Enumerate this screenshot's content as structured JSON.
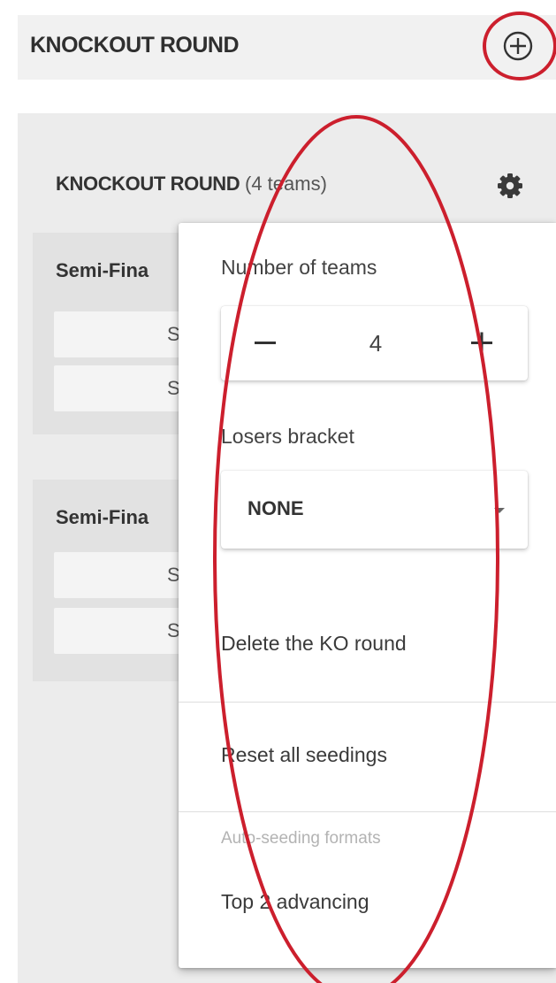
{
  "header": {
    "title": "KNOCKOUT ROUND"
  },
  "round": {
    "title": "KNOCKOUT ROUND",
    "team_count_label": "(4 teams)"
  },
  "matches": [
    {
      "title": "Semi-Fina",
      "slots": [
        "S",
        "S"
      ]
    },
    {
      "title": "Semi-Fina",
      "slots": [
        "S",
        "S"
      ]
    }
  ],
  "menu": {
    "number_of_teams_label": "Number of teams",
    "number_of_teams_value": "4",
    "losers_bracket_label": "Losers bracket",
    "losers_bracket_value": "NONE",
    "delete_label": "Delete the KO round",
    "reset_label": "Reset all seedings",
    "auto_seeding_header": "Auto-seeding formats",
    "auto_seeding_items": [
      "Top 2 advancing"
    ]
  },
  "colors": {
    "annotation": "#cc1f2d",
    "panel": "#ececec",
    "header": "#f1f1f1"
  },
  "icons": {
    "add": "plus-circle-icon",
    "settings": "gear-icon",
    "dropdown": "caret-down-icon"
  }
}
